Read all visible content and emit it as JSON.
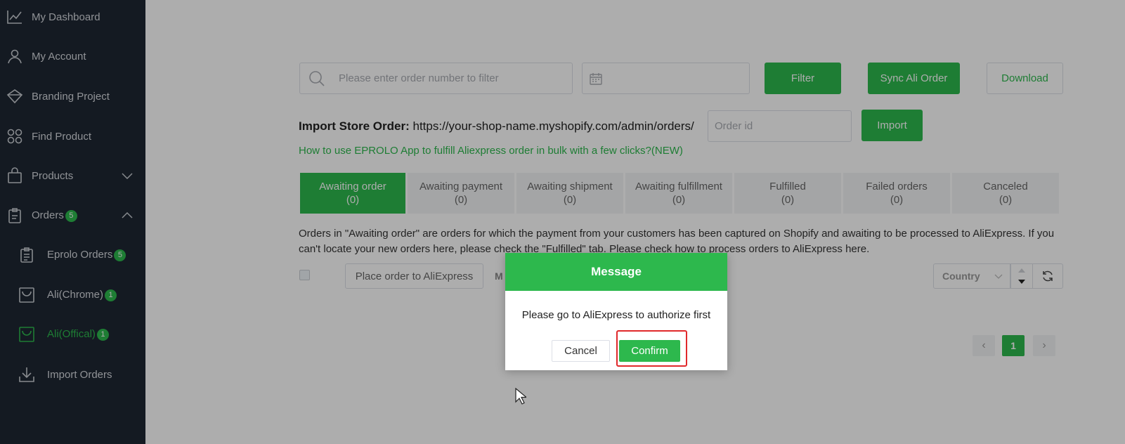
{
  "sidebar": {
    "items": [
      {
        "label": "My Dashboard",
        "icon": "chart-line-icon"
      },
      {
        "label": "My Account",
        "icon": "user-icon"
      },
      {
        "label": "Branding Project",
        "icon": "diamond-icon"
      },
      {
        "label": "Find Product",
        "icon": "grid-icon"
      },
      {
        "label": "Products",
        "icon": "bag-icon"
      },
      {
        "label": "Orders",
        "icon": "clipboard-icon",
        "badge": "5"
      },
      {
        "label": "Eprolo Orders",
        "icon": "list-icon",
        "badge": "5"
      },
      {
        "label": "Ali(Chrome)",
        "icon": "cart-icon",
        "badge": "1"
      },
      {
        "label": "Ali(Offical)",
        "icon": "cart-icon",
        "badge": "1"
      },
      {
        "label": "Import Orders",
        "icon": "download-icon"
      }
    ]
  },
  "filter": {
    "search_placeholder": "Please enter order number to filter",
    "filter_label": "Filter",
    "sync_label": "Sync Ali Order",
    "download_label": "Download"
  },
  "import": {
    "title": "Import Store Order:",
    "url": "https://your-shop-name.myshopify.com/admin/orders/",
    "order_placeholder": "Order id",
    "button_label": "Import",
    "help_link": "How to use EPROLO App to fulfill Aliexpress order in bulk with a few clicks?(NEW)"
  },
  "tabs": [
    {
      "label": "Awaiting order",
      "count": "(0)"
    },
    {
      "label": "Awaiting payment",
      "count": "(0)"
    },
    {
      "label": "Awaiting shipment",
      "count": "(0)"
    },
    {
      "label": "Awaiting fulfillment",
      "count": "(0)"
    },
    {
      "label": "Fulfilled",
      "count": "(0)"
    },
    {
      "label": "Failed orders",
      "count": "(0)"
    },
    {
      "label": "Canceled",
      "count": "(0)"
    }
  ],
  "description": "Orders in \"Awaiting order\" are orders for which the payment from your customers has been captured on Shopify and awaiting to be processed to AliExpress. If you can't locate your new orders here, please check the \"Fulfilled\" tab. Please check how to process orders to AliExpress here.",
  "toolbar": {
    "place_order_label": "Place order to AliExpress",
    "more_label": "M",
    "country_placeholder": "Country"
  },
  "pagination": {
    "current_page": "1"
  },
  "dialog": {
    "title": "Message",
    "message": "Please go to AliExpress to authorize first",
    "cancel_label": "Cancel",
    "confirm_label": "Confirm"
  },
  "colors": {
    "accent": "#2db84d",
    "sidebar_bg": "#1e2733",
    "highlight": "#e0292b"
  }
}
